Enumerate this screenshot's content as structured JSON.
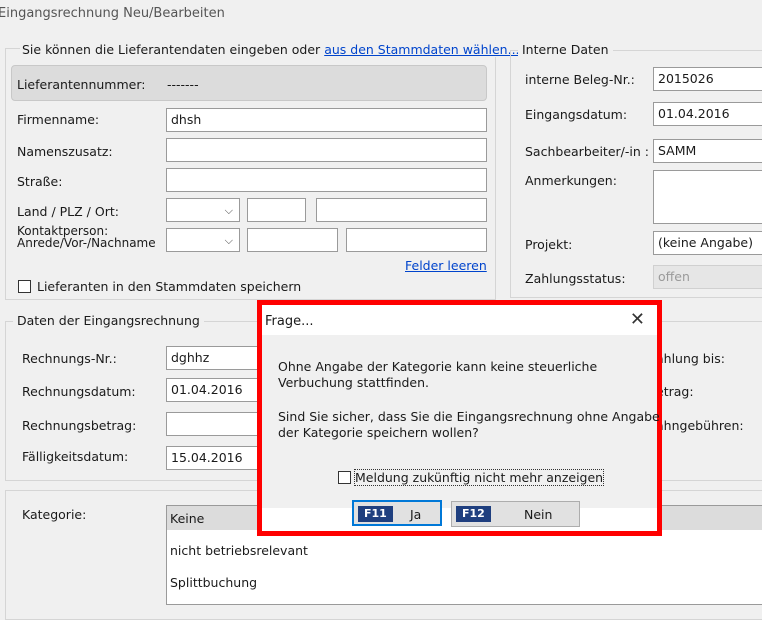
{
  "window": {
    "title": "Eingangsrechnung Neu/Bearbeiten"
  },
  "supplier": {
    "intro_text": "Sie können die Lieferantendaten eingeben oder",
    "intro_link": "aus den Stammdaten wählen...",
    "number_label": "Lieferantennummer:",
    "number_value": "-------",
    "company_label": "Firmenname:",
    "company_value": "dhsh",
    "name_suffix_label": "Namenszusatz:",
    "street_label": "Straße:",
    "country_label": "Land / PLZ / Ort:",
    "contact_label_1": "Kontaktperson:",
    "contact_label_2": "Anrede/Vor-/Nachname",
    "clear_link": "Felder leeren",
    "save_checkbox_label": "Lieferanten in den Stammdaten speichern"
  },
  "internal": {
    "group_title": "Interne Daten",
    "doc_no_label": "interne Beleg-Nr.:",
    "doc_no_value": "2015026",
    "received_label": "Eingangsdatum:",
    "received_value": "01.04.2016",
    "clerk_label": "Sachbearbeiter/-in :",
    "clerk_value": "SAMM",
    "notes_label": "Anmerkungen:",
    "project_label": "Projekt:",
    "project_value": "(keine Angabe)",
    "payment_status_label": "Zahlungsstatus:",
    "payment_status_value": "offen"
  },
  "invoice": {
    "group_title": "Daten der Eingangsrechnung",
    "number_label": "Rechnungs-Nr.:",
    "number_value": "dghhz",
    "date_label": "Rechnungsdatum:",
    "date_value": "01.04.2016",
    "amount_label": "Rechnungsbetrag:",
    "due_label": "Fälligkeitsdatum:",
    "due_value": "15.04.2016",
    "right_label_1": "ahlung bis:",
    "right_label_2": "etrag:",
    "right_label_3": "ahngebühren:"
  },
  "category": {
    "label": "Kategorie:",
    "items": [
      "Keine",
      "nicht betriebsrelevant",
      "Splittbuchung"
    ]
  },
  "dialog": {
    "title": "Frage...",
    "line1": "Ohne Angabe der Kategorie kann keine steuerliche",
    "line2": "Verbuchung stattfinden.",
    "line3": "Sind Sie sicher, dass Sie die Eingangsrechnung ohne Angabe",
    "line4": "der Kategorie speichern wollen?",
    "checkbox_label": "Meldung zukünftig nicht mehr anzeigen",
    "yes_key": "F11",
    "yes_label": "Ja",
    "no_key": "F12",
    "no_label": "Nein"
  }
}
